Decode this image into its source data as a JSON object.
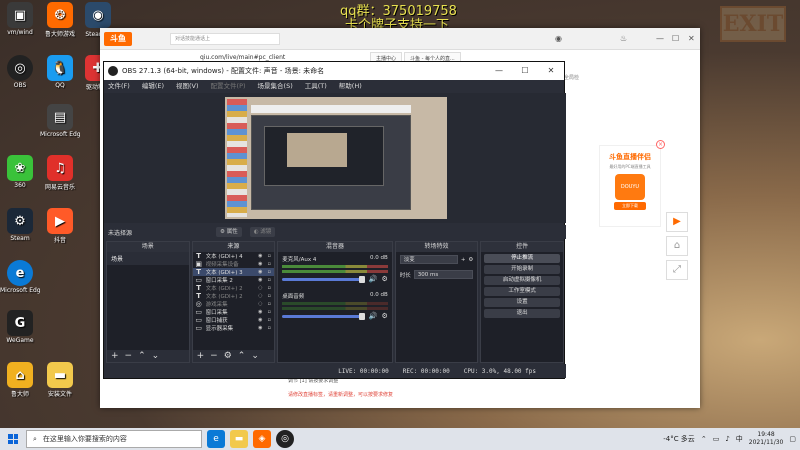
{
  "overlay": {
    "qq_line": "qq群：375019758",
    "support_line": "卡个牌子支持一下",
    "exit_sign": "EXIT"
  },
  "desktop_icons": [
    {
      "label": "vm/wind",
      "icon": "app-icon",
      "color": "#3a3a3a"
    },
    {
      "label": "鲁大师游戏",
      "icon": "app-icon",
      "color": "#ff6a00"
    },
    {
      "label": "Steam库",
      "icon": "app-icon",
      "color": "#2b4a6b"
    },
    {
      "label": "OBS",
      "icon": "obs-icon",
      "color": "#222"
    },
    {
      "label": "QQ",
      "icon": "qq-icon",
      "color": "#1a9cf0"
    },
    {
      "label": "驱动精灵",
      "icon": "app-icon",
      "color": "#d33"
    },
    {
      "label": "Microsoft Edge",
      "icon": "edge-icon",
      "color": "#0a7ad6"
    },
    {
      "label": "网易云音乐",
      "icon": "music-icon",
      "color": "#e0302a"
    },
    {
      "label": "360",
      "icon": "app-icon",
      "color": "#2a8a2a"
    },
    {
      "label": "Steam",
      "icon": "steam-icon",
      "color": "#1b2838"
    },
    {
      "label": "WeGame",
      "icon": "wegame-icon",
      "color": "#222"
    }
  ],
  "browser": {
    "logo": "斗鱼",
    "address_placeholder": "对话技能通话上",
    "address": "qiu.com/live/main#pc_client",
    "tabs": [
      "主播中心",
      "斗鱼 - 每个人的直..."
    ],
    "right_text": "全局检",
    "bottom_text1": "调节 [1] 请按要求调整",
    "bottom_text2": "请修改直播标签，请重新调整，可以按要求修复"
  },
  "promo": {
    "title": "斗鱼直播伴侣",
    "subtitle": "最好用的PC端直播工具",
    "logo_text": "DOUYU",
    "button": "立即下载"
  },
  "obs": {
    "title": "OBS 27.1.3 (64-bit, windows) - 配置文件: 声音 - 场景: 未命名",
    "menu": [
      "文件(F)",
      "编辑(E)",
      "视图(V)",
      "配置文件(P)",
      "场景集合(S)",
      "工具(T)",
      "帮助(H)"
    ],
    "selected_label": "未选择源",
    "properties_btn": "属性",
    "filters_btn": "滤镜",
    "docks": {
      "scenes": {
        "title": "场景",
        "items": [
          "场景"
        ]
      },
      "sources": {
        "title": "来源",
        "items": [
          {
            "name": "文本 (GDI+) 4",
            "icon": "T",
            "hidden": false,
            "selected": false
          },
          {
            "name": "视频采集设备",
            "icon": "T",
            "hidden": false,
            "selected": false
          },
          {
            "name": "文本 (GDI+) 3",
            "icon": "T",
            "hidden": false,
            "selected": true
          },
          {
            "name": "窗口采集 2",
            "icon": "▭",
            "hidden": false,
            "selected": false
          },
          {
            "name": "文本 (GDI+) 2",
            "icon": "T",
            "hidden": true,
            "selected": false
          },
          {
            "name": "文本 (GDI+) 2",
            "icon": "T",
            "hidden": true,
            "selected": false
          },
          {
            "name": "游戏采集",
            "icon": "◎",
            "hidden": true,
            "selected": false
          },
          {
            "name": "窗口采集",
            "icon": "▭",
            "hidden": false,
            "selected": false
          },
          {
            "name": "窗口捕获",
            "icon": "▭",
            "hidden": false,
            "selected": false
          },
          {
            "name": "显示器采集",
            "icon": "▭",
            "hidden": false,
            "selected": false
          }
        ]
      },
      "mixer": {
        "title": "混音器",
        "channels": [
          {
            "name": "麦克风/Aux 4",
            "level": "0.0 dB"
          },
          {
            "name": "桌面音频",
            "level": "0.0 dB"
          }
        ]
      },
      "transitions": {
        "title": "转场特效",
        "type": "淡变",
        "duration_label": "时长",
        "duration": "300 ms"
      },
      "controls": {
        "title": "控件",
        "buttons": [
          "停止推流",
          "开始录制",
          "启动虚拟摄像机",
          "工作室模式",
          "设置",
          "退出"
        ]
      }
    },
    "status": {
      "live": "LIVE: 00:00:00",
      "rec": "REC: 00:00:00",
      "cpu": "CPU: 3.0%, 48.00 fps"
    }
  },
  "taskbar": {
    "search_placeholder": "在这里输入你要搜索的内容",
    "weather": "-4°C  多云",
    "lang": "中",
    "time": "19:48",
    "date": "2021/11/30"
  }
}
